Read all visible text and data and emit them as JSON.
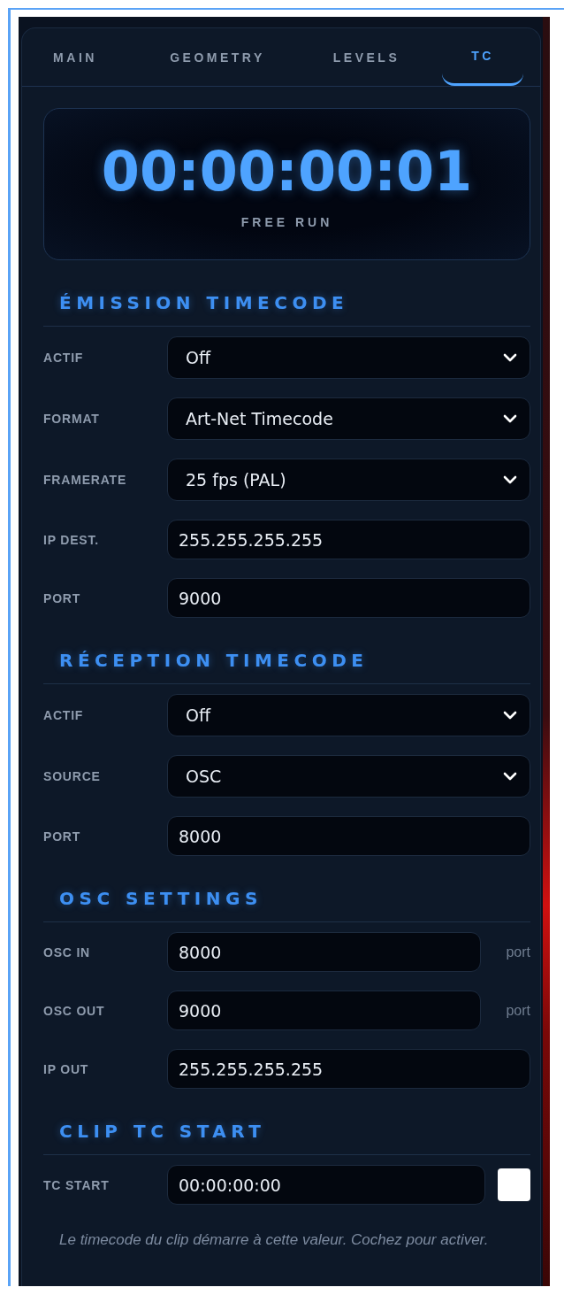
{
  "tabs": [
    {
      "label": "MAIN",
      "selected": false
    },
    {
      "label": "GEOMETRY",
      "selected": false
    },
    {
      "label": "LEVELS",
      "selected": false
    },
    {
      "label": "TC",
      "selected": true
    }
  ],
  "timecode": {
    "value": "00:00:00:01",
    "mode": "FREE RUN"
  },
  "sections": [
    {
      "title": "ÉMISSION TIMECODE",
      "rows": [
        {
          "kind": "select",
          "label": "ACTIF",
          "value": "Off"
        },
        {
          "kind": "select",
          "label": "FORMAT",
          "value": "Art-Net Timecode"
        },
        {
          "kind": "select",
          "label": "FRAMERATE",
          "value": "25 fps (PAL)"
        },
        {
          "kind": "input",
          "label": "IP DEST.",
          "value": "255.255.255.255"
        },
        {
          "kind": "input",
          "label": "PORT",
          "value": "9000"
        }
      ]
    },
    {
      "title": "RÉCEPTION TIMECODE",
      "rows": [
        {
          "kind": "select",
          "label": "ACTIF",
          "value": "Off"
        },
        {
          "kind": "select",
          "label": "SOURCE",
          "value": "OSC"
        },
        {
          "kind": "input",
          "label": "PORT",
          "value": "8000"
        }
      ]
    },
    {
      "title": "OSC SETTINGS",
      "rows": [
        {
          "kind": "unit",
          "label": "OSC IN",
          "value": "8000",
          "unit": "port"
        },
        {
          "kind": "unit",
          "label": "OSC OUT",
          "value": "9000",
          "unit": "port"
        },
        {
          "kind": "input",
          "label": "IP OUT",
          "value": "255.255.255.255"
        }
      ]
    },
    {
      "title": "CLIP TC START",
      "rows": [
        {
          "kind": "check",
          "label": "TC START",
          "value": "00:00:00:00",
          "checked": false
        }
      ],
      "note": "Le timecode du clip démarre à cette valeur. Cochez pour activer."
    }
  ]
}
